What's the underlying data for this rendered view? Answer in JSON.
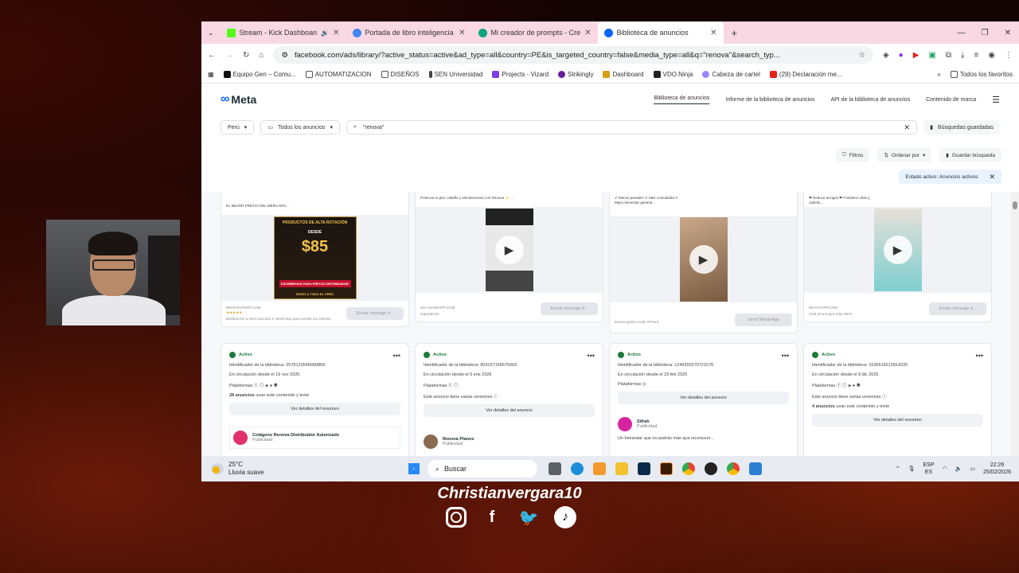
{
  "browser": {
    "tabs": [
      {
        "label": "Stream - Kick Dashboard",
        "color": "#53fc18",
        "active": false
      },
      {
        "label": "Portada de libro inteligencia ar",
        "color": "#4285f4",
        "active": false
      },
      {
        "label": "Mi creador de prompts - Creac",
        "color": "#10a37f",
        "active": false
      },
      {
        "label": "Biblioteca de anuncios",
        "color": "#0866ff",
        "active": true
      }
    ],
    "url": "facebook.com/ads/library/?active_status=active&ad_type=all&country=PE&is_targeted_country=false&media_type=all&q=\"renova\"&search_typ...",
    "bookmarks": [
      "Equipo Gen – Comu...",
      "AUTOMATIZACION",
      "DISEÑOS",
      "SEN Universidad",
      "Projects - Vizard",
      "Strikingly",
      "Dashboard",
      "VDO.Ninja",
      "Cabeza de cartel",
      "(29) Declaración me..."
    ],
    "all_bookmarks": "Todos los favoritos"
  },
  "meta": {
    "logo": "Meta",
    "nav": [
      "Biblioteca de anuncios",
      "Informe de la biblioteca de anuncios",
      "API de la biblioteca de anuncios",
      "Contenido de marca"
    ],
    "country": "Perú",
    "ad_category": "Todos los anuncios",
    "search_value": "\"renova\"",
    "saved_searches": "Búsquedas guardadas",
    "filters": "Filtros",
    "sort": "Ordenar por",
    "save_search": "Guardar búsqueda",
    "active_chip": "Estado activo: Anuncios activos"
  },
  "top_cards": [
    {
      "caption": "EL MEJOR PRECIO DEL MERCADO...",
      "site": "RENOVAPOINT.COM",
      "sub": "Distribución a nivel nacional ✔ Stock listo para vender los mismos",
      "button": "Enviar mensaje d...",
      "poster_title": "PRODUCTOS DE ALTA ROTACIÓN",
      "poster_desde": "DESDE",
      "poster_price": "$85",
      "poster_bar": "ESCRÍBENOS PARA PRECIO DISTRIBUIDOR",
      "poster_env": "ENVÍO A TODO EL PERÚ"
    },
    {
      "caption": "Potencia tu piel, cabello y articulaciones con Renova ✨ ...",
      "site": "WA.AVANDAPP.COM",
      "sub": "Importación",
      "button": "Enviar mensaje d..."
    },
    {
      "caption": "✔ Menos pesadez  ✔ Más comodidad  ✔ Mejor bienestar general...",
      "site": "",
      "sub": "Envíos gratis a todo el Perú",
      "button": "Send WhatsApp"
    },
    {
      "caption": "❤ Reduce arrugas  ❤ Fortalece uñas y cabello...",
      "site": "WHATSAPP.COM",
      "sub": "Chat ahora para más INFO",
      "button": "Enviar mensaje d..."
    }
  ],
  "ads": [
    {
      "status": "Activo",
      "library_id": "Identificador de la biblioteca: 2578120545680869",
      "running": "En circulación desde el 19 nov 2025",
      "platforms_label": "Plataformas",
      "extra_bold": "28 anuncios",
      "extra_rest": " usan este contenido y texto",
      "button": "Ver detalles del resumen",
      "advertiser": "Colágeno Renova Distribuidor Autorizado",
      "advertiser_sub": "Publicidad",
      "avatar_color": "#e1306c"
    },
    {
      "status": "Activo",
      "library_id": "Identificador de la biblioteca: 903157156675093",
      "running": "En circulación desde el 5 ene 2026",
      "platforms_label": "Plataformas",
      "extra_note": "Este anuncio tiene varias versiones",
      "button": "Ver detalles del anuncio",
      "advertiser": "Renova Planos",
      "advertiser_sub": "Publicidad",
      "avatar_color": "#8a6a50"
    },
    {
      "status": "Activo",
      "library_id": "Identificador de la biblioteca: 1249293270721576",
      "running": "En circulación desde el 23 feb 2026",
      "platforms_label": "Plataformas",
      "button": "Ver detalles del anuncio",
      "advertiser": "Sifrah",
      "advertiser_sub": "Publicidad",
      "advertiser_text": "Un bienestar que no podrás más que reconocer...",
      "avatar_color": "#d6249f"
    },
    {
      "status": "Activo",
      "library_id": "Identificador de la biblioteca: 1635618212814225",
      "running": "En circulación desde el 9 dic 2025",
      "platforms_label": "Plataformas",
      "extra_note": "Este anuncio tiene varias versiones",
      "extra_bold": "4 anuncios",
      "extra_rest": " usan este contenido y texto",
      "button": "Ver detalles del resumen"
    }
  ],
  "taskbar": {
    "temp": "25°C",
    "weather": "Lluvia suave",
    "search": "Buscar",
    "lang": "ESP",
    "lang2": "ES",
    "time": "22:26",
    "date": "25/02/2026"
  },
  "overlay": {
    "handle": "Christianvergara10"
  }
}
